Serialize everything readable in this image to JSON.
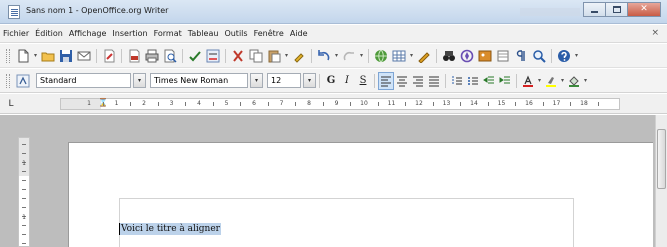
{
  "window": {
    "title": "Sans nom 1 - OpenOffice.org Writer",
    "controls": {
      "minimize": "minimize",
      "maximize": "maximize",
      "close": "✕"
    }
  },
  "menu": {
    "items": [
      "Fichier",
      "Édition",
      "Affichage",
      "Insertion",
      "Format",
      "Tableau",
      "Outils",
      "Fenêtre",
      "Aide"
    ],
    "close_glyph": "×"
  },
  "standard_toolbar": {
    "icons": [
      "new-document-icon",
      "open-icon",
      "save-icon",
      "email-icon",
      "edit-file-icon",
      "export-pdf-icon",
      "print-icon",
      "print-preview-icon",
      "spellcheck-icon",
      "autospellcheck-icon",
      "cut-icon",
      "copy-icon",
      "paste-icon",
      "clone-format-icon",
      "undo-icon",
      "redo-icon",
      "hyperlink-icon",
      "table-icon",
      "draw-functions-icon",
      "find-replace-icon",
      "navigator-icon",
      "gallery-icon",
      "datasources-icon",
      "nonprinting-chars-icon",
      "zoom-icon",
      "help-icon"
    ]
  },
  "format_toolbar": {
    "paragraph_style": "Standard",
    "font_name": "Times New Roman",
    "font_size": "12",
    "bold": "G",
    "italic": "I",
    "underline": "S",
    "font_color": "#d42020",
    "highlight_color": "#ffff00",
    "background_color": "#3b8a3b"
  },
  "ruler": {
    "corner_glyph": "L",
    "numbers": [
      "1",
      "1",
      "2",
      "3",
      "4",
      "5",
      "6",
      "7",
      "8",
      "9",
      "10",
      "11",
      "12",
      "13",
      "14",
      "15",
      "16",
      "17",
      "18"
    ]
  },
  "vruler": {
    "numbers": [
      "1",
      "1"
    ]
  },
  "document": {
    "text": "Voici le titre à aligner"
  }
}
